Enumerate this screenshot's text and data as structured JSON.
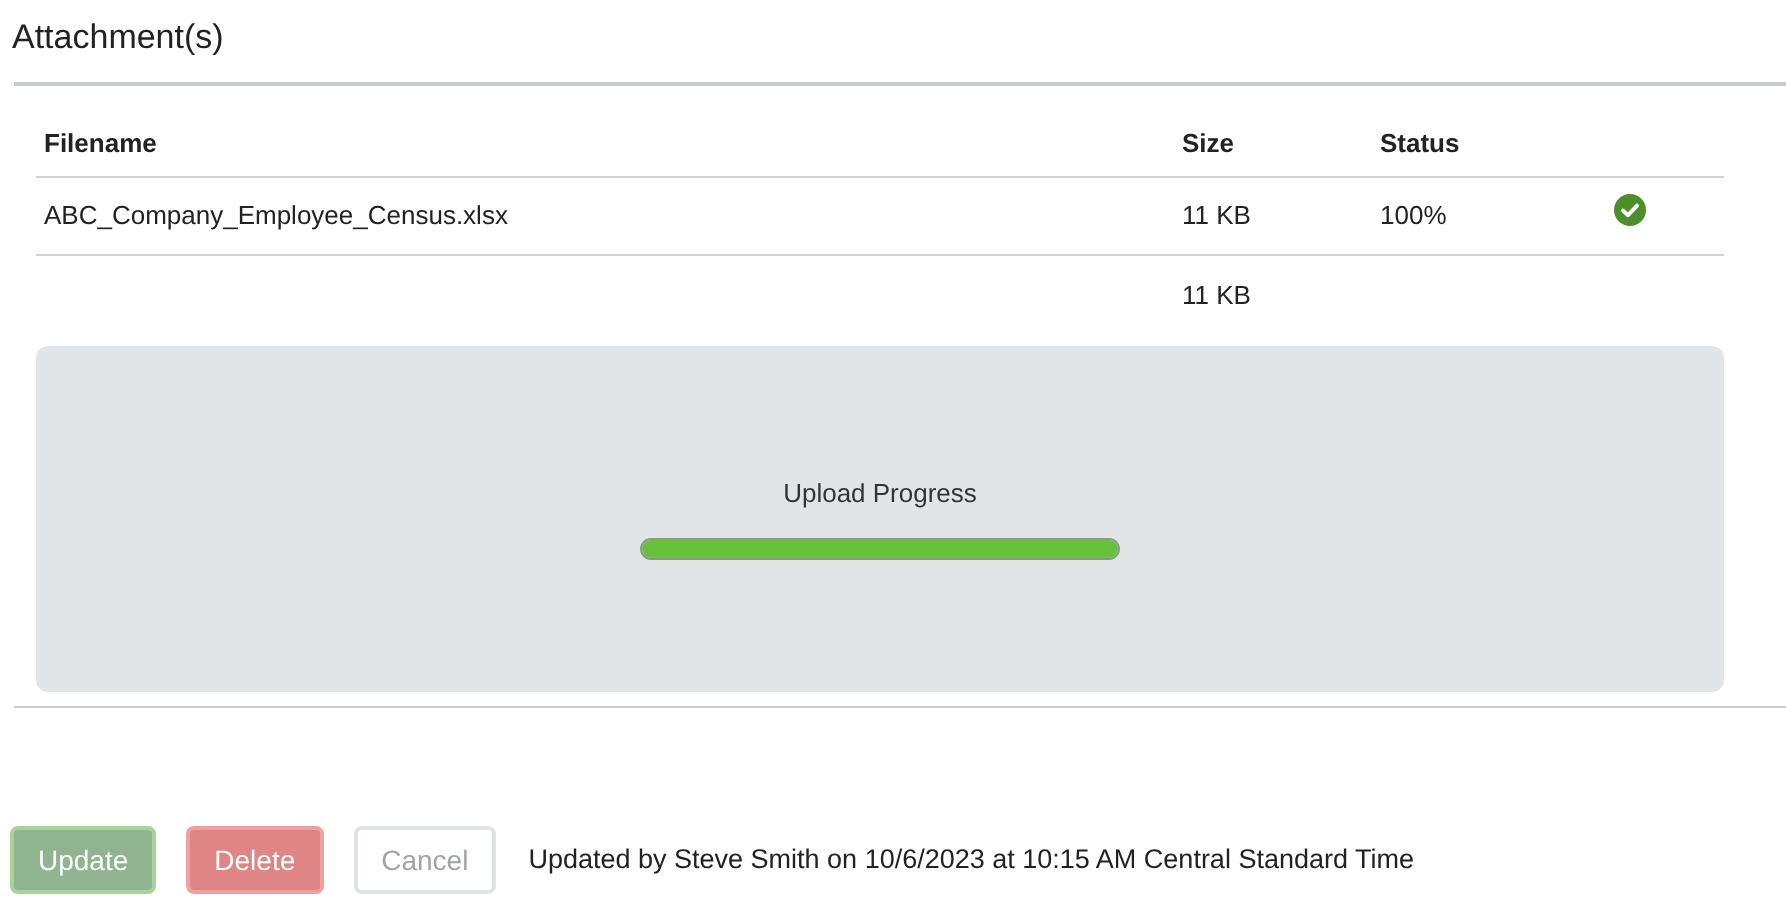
{
  "title": "Attachment(s)",
  "table": {
    "columns": [
      "Filename",
      "Size",
      "Status"
    ],
    "rows": [
      {
        "filename": "ABC_Company_Employee_Census.xlsx",
        "size": "11 KB",
        "status": "100%",
        "complete": true
      }
    ],
    "total": {
      "size": "11 KB"
    }
  },
  "upload": {
    "label": "Upload Progress",
    "level": 1
  },
  "buttons": [
    {
      "label": "Update",
      "kind": "primary",
      "disabled": true
    },
    {
      "label": "Delete",
      "kind": "danger",
      "disabled": true
    },
    {
      "label": "Cancel",
      "kind": "secondary",
      "disabled": true
    }
  ],
  "updated_text": "Updated by Steve Smith on 10/6/2023 at 10:15 AM Central Standard Time"
}
